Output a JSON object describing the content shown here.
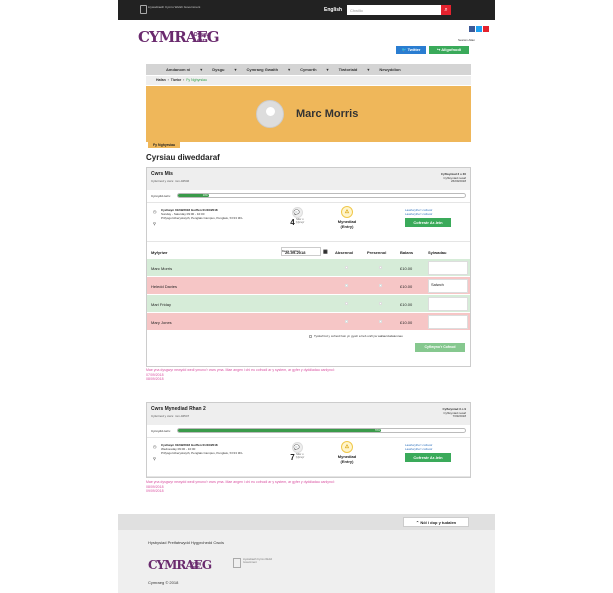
{
  "topbar": {
    "gov_label": "Llywodraeth Cymru\nWelsh Government",
    "lang": "English",
    "search_placeholder": "Chwilio",
    "search_icon": "search-icon"
  },
  "header": {
    "logo_text": "CYMRAEG",
    "logo_sub1": "Dysgu",
    "logo_sub2": "Learn",
    "signin": "Sesiwn Allan",
    "twitter_label": "Twitter",
    "profile_label": "Allgofnodi",
    "social_colors": [
      "#3b5998",
      "#1da1f2",
      "#e4222e"
    ]
  },
  "nav": [
    "Amdanom ni",
    "Dysgu",
    "Cymraeg Gwaith",
    "Cymorth",
    "Tiwtoriaid",
    "Newyddion"
  ],
  "breadcrumb": {
    "home": "Hafan",
    "tutor": "Tiwtor",
    "current": "Fy Nghyrsiau"
  },
  "profile": {
    "name": "Marc Morris"
  },
  "subtab": "Fy Nghyrsiau",
  "section_title": "Cyrsiau diweddaraf",
  "course1": {
    "title": "Cwrs Mis",
    "code": "Cyfeirnod y cwrs: mm-04546",
    "right1": "Cyflwyniad 3 o 30",
    "right2": "Cyflwyniad nesaf",
    "right3": "26/09/2018",
    "progress_label": "Cynnydd cwrs:",
    "progress": 0.1,
    "progress_text": "10%",
    "dates": "Cychwyn 01/09/2018 Gorffen 01/10/2018",
    "days": "Sunday - Saturday 09:00 - 10:00",
    "place": "Prifysgol Aberystwyth, Penglais Campus, Penglais, SY23 3FL",
    "count": "4",
    "count_label": "Nifer o fyfyrwyr",
    "level": "Mynediad (Entry)",
    "link1": "Lawrlwytho'r cofrestr",
    "link2": "Lawrlwytho'r cofrestr",
    "action": "Cofrestr Ar-lein",
    "date_label": "Dewis dyddiad",
    "date_value": "26-09-2018",
    "headers": [
      "Myfyriwr",
      "Absennol",
      "Presennol",
      "Balans",
      "Sylwadau"
    ],
    "rows": [
      {
        "name": "Marc Morris",
        "status": "ok",
        "balance": "£10.00",
        "comment": ""
      },
      {
        "name": "Heledd Davies",
        "status": "bad",
        "balance": "£10.00",
        "comment": "Salwch"
      },
      {
        "name": "Mari Friday",
        "status": "ok",
        "balance": "£10.00",
        "comment": ""
      },
      {
        "name": "Mary Jones",
        "status": "bad",
        "balance": "£10.00",
        "comment": ""
      }
    ],
    "check_text": "Tystiaf fod y cofnod hwn yn gywir a heb unrhyw wallau/dudalennau",
    "save": "Cyflwyno'r Cofnod",
    "warning1": "Mae yna dysgwyr newydd wedi ymuno'r cwrs yma. Mae angen i chi eu cofnodi ar y system, ar gyfer y dyddiadau canlynol:",
    "warning2": "07/09/2018",
    "warning3": "08/09/2018"
  },
  "course2": {
    "title": "Cwrs Mynediad Rhan 2",
    "code": "Cyfeirnod y cwrs: mm-04547",
    "right1": "Cyflwyniad 3 o 9",
    "right2": "Cyflwyniad nesaf",
    "right3": "7/09/2018",
    "progress_label": "Cynnydd cwrs:",
    "progress": 0.7,
    "progress_text": "70%",
    "dates": "Cychwyn 01/09/2018 Gorffen 01/10/2018",
    "days": "Wednesday 09:00 - 10:00",
    "place": "Prifysgol Aberystwyth, Penglais Campus, Penglais, SY23 3FL",
    "count": "7",
    "count_label": "Nifer o fyfyrwyr",
    "level": "Mynediad (Entry)",
    "link1": "Lawrlwytho'r cofrestr",
    "link2": "Lawrlwytho'r cofrestr",
    "action": "Cofrestr Ar-lein",
    "warning1": "Mae yna dysgwyr newydd wedi ymuno'r cwrs yma. Mae angen i chi eu cofnodi ar y system, ar gyfer y dyddiadau canlynol:",
    "warning2": "08/09/2018",
    "warning3": "09/09/2018"
  },
  "footer": {
    "back_to_top": "Nôl i dop y tudalen",
    "links": "Hysbysiad Preifatrwydd   Hygyrchedd   Cwcis",
    "copyright": "Cymraeg © 2018"
  }
}
